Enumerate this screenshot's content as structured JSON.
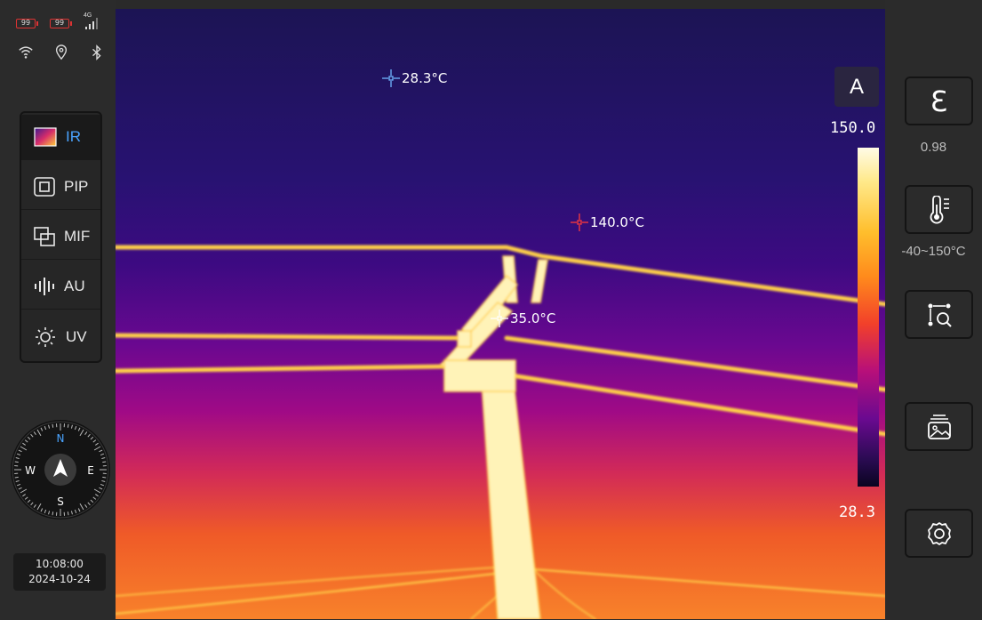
{
  "status": {
    "battery_1": "99",
    "battery_2": "99",
    "network": "4G"
  },
  "modes": [
    {
      "label": "IR",
      "active": true
    },
    {
      "label": "PIP",
      "active": false
    },
    {
      "label": "MIF",
      "active": false
    },
    {
      "label": "AU",
      "active": false
    },
    {
      "label": "UV",
      "active": false
    }
  ],
  "compass": {
    "north": "N",
    "south": "S",
    "east": "E",
    "west": "W"
  },
  "datetime": {
    "time": "10:08:00",
    "date": "2024-10-24"
  },
  "spots": [
    {
      "label": "28.3°C",
      "color": "#6fb6ff"
    },
    {
      "label": "140.0°C",
      "color": "#ff3b3b"
    },
    {
      "label": "35.0°C",
      "color": "#ffffff"
    }
  ],
  "scale": {
    "mode": "A",
    "max": "150.0",
    "min": "28.3"
  },
  "right": {
    "emissivity_symbol": "Ɛ",
    "emissivity_value": "0.98",
    "range_value": "-40~150°C"
  },
  "colors": {
    "accent": "#4aa3ff",
    "battery": "#d33333"
  }
}
